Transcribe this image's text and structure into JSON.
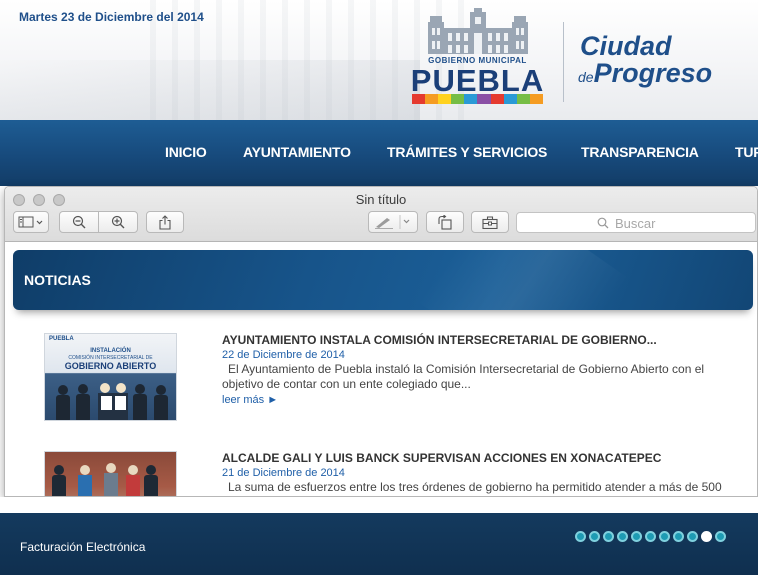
{
  "header": {
    "date": "Martes 23 de Diciembre del 2014",
    "logo_gobierno": "GOBIERNO MUNICIPAL",
    "logo_city": "PUEBLA",
    "logo_bar_colors": [
      "#e53a2f",
      "#f59c22",
      "#ffd21f",
      "#76bd45",
      "#2a9ad6",
      "#8a4fa5",
      "#e53a2f",
      "#2a9ad6",
      "#76bd45",
      "#f59c22"
    ],
    "slogan_ciudad": "Ciudad",
    "slogan_de": "de",
    "slogan_progreso": "Progreso"
  },
  "nav": {
    "items": [
      "INICIO",
      "AYUNTAMIENTO",
      "TRÁMITES Y SERVICIOS",
      "TRANSPARENCIA",
      "TUR"
    ]
  },
  "window": {
    "title": "Sin título",
    "search_placeholder": "Buscar",
    "toolbar_icons": [
      "sidebar-icon",
      "zoom-out-icon",
      "zoom-in-icon",
      "share-icon",
      "markup-pen-icon",
      "rotate-icon",
      "toolbox-icon"
    ]
  },
  "document": {
    "section_title": "NOTICIAS",
    "news": [
      {
        "title": "AYUNTAMIENTO INSTALA COMISIÓN INTERSECRETARIAL DE GOBIERNO...",
        "date": "22 de Diciembre de 2014",
        "summary": "El Ayuntamiento de Puebla instaló la Comisión Intersecretarial de Gobierno Abierto con el objetivo de contar con un ente colegiado que...",
        "more": "leer más ►",
        "thumb_caption_top": "INSTALACIÓN",
        "thumb_caption_mid": "COMISIÓN INTERSECRETARIAL DE",
        "thumb_caption_big": "GOBIERNO ABIERTO"
      },
      {
        "title": "ALCALDE GALI Y LUIS BANCK SUPERVISAN ACCIONES EN XONACATEPEC",
        "date": "21 de Diciembre de 2014",
        "summary": "La suma de esfuerzos entre los tres órdenes de gobierno ha permitido atender a más de 500"
      }
    ]
  },
  "footer": {
    "label": "Facturación Electrónica",
    "carousel_dot_count": 11,
    "carousel_active_index": 9
  }
}
